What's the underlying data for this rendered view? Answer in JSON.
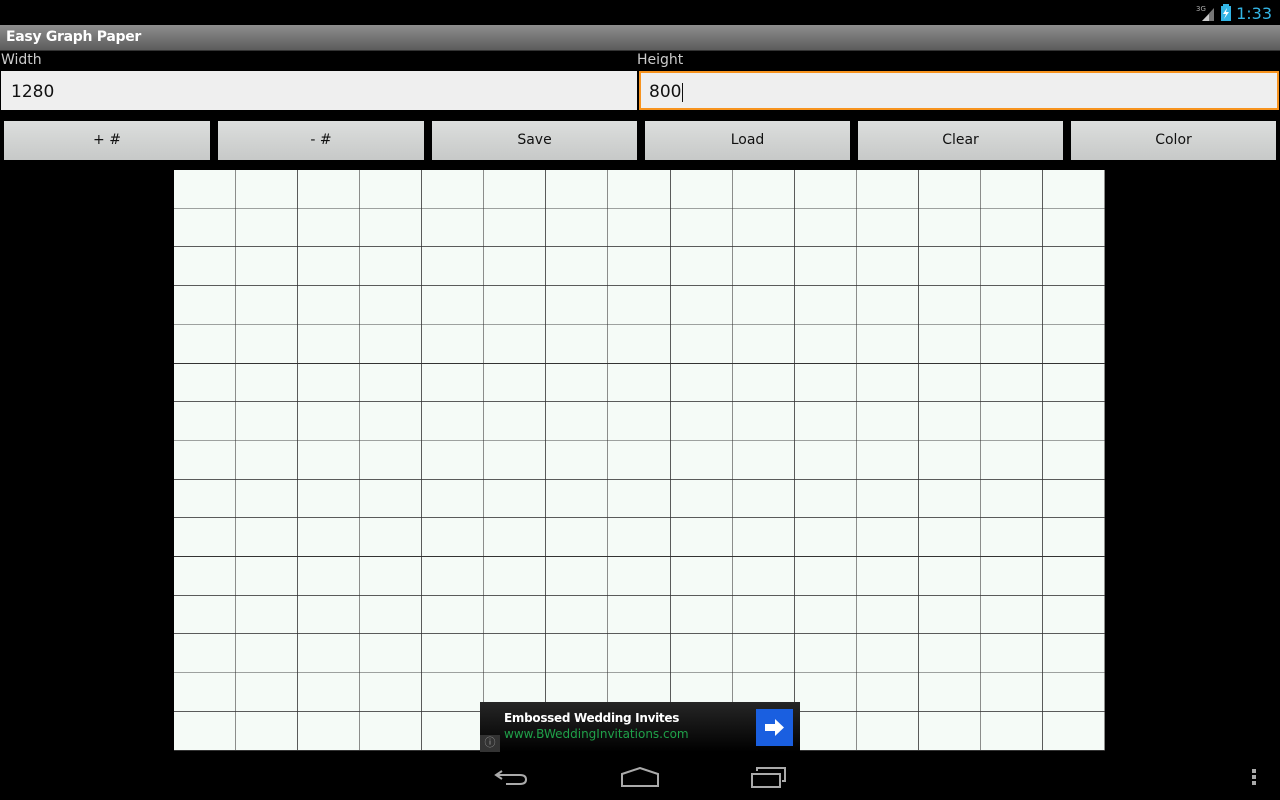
{
  "status_bar": {
    "network": "3G",
    "time": "1:33",
    "clock_color": "#33b5e5"
  },
  "app": {
    "title": "Easy Graph Paper"
  },
  "form": {
    "width_label": "Width",
    "width_value": "1280",
    "height_label": "Height",
    "height_value": "800",
    "focus_color": "#f7931e"
  },
  "toolbar": {
    "buttons": [
      {
        "id": "add-grid",
        "label": "+ #"
      },
      {
        "id": "remove-grid",
        "label": "- #"
      },
      {
        "id": "save",
        "label": "Save"
      },
      {
        "id": "load",
        "label": "Load"
      },
      {
        "id": "clear",
        "label": "Clear"
      },
      {
        "id": "color",
        "label": "Color"
      }
    ]
  },
  "graph": {
    "columns": 15,
    "rows": 15,
    "paper_color": "#f5fbf7",
    "line_color": "#333333"
  },
  "ad": {
    "title": "Embossed Wedding Invites",
    "url": "www.BWeddingInvitations.com",
    "info_icon": "ⓘ",
    "url_color": "#1fa149",
    "button_color": "#1a5fe0"
  },
  "nav": {
    "back": "back-icon",
    "home": "home-icon",
    "recents": "recents-icon",
    "menu": "overflow-menu-icon"
  }
}
